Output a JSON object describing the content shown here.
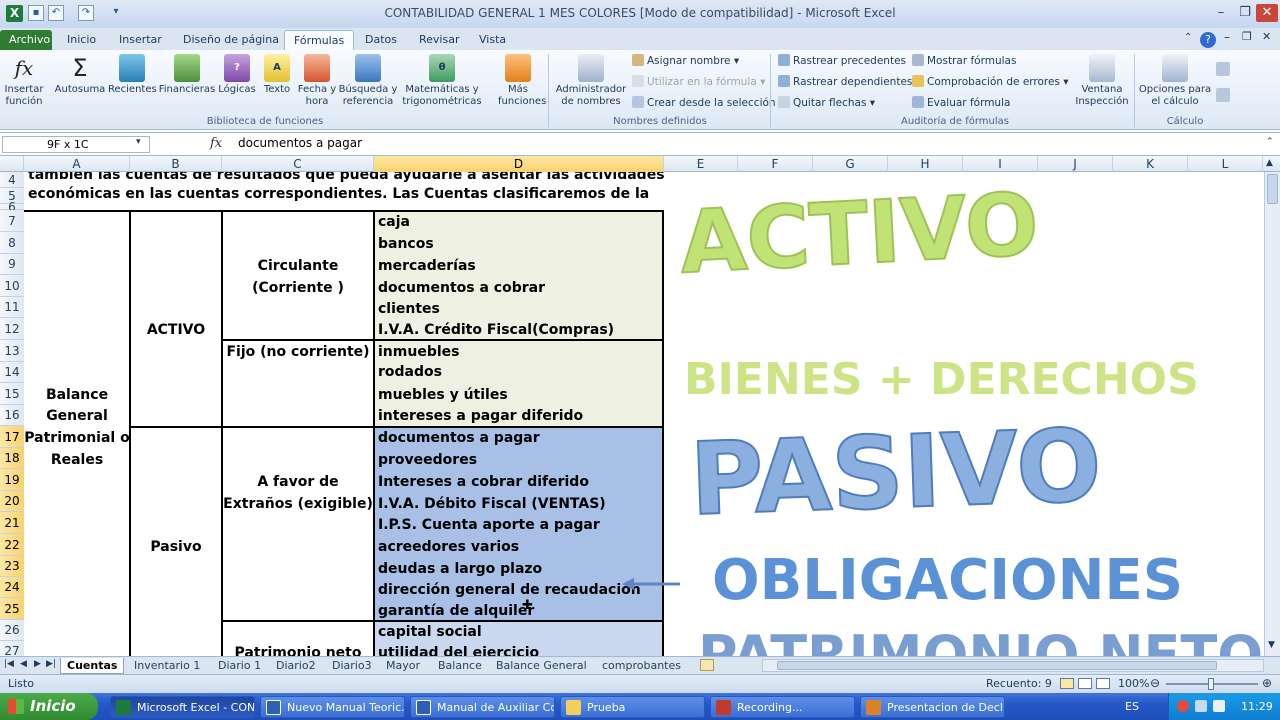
{
  "window": {
    "title": "CONTABILIDAD GENERAL 1 MES COLORES  [Modo de compatibilidad] - Microsoft Excel"
  },
  "ribbon_tabs": [
    "Archivo",
    "Inicio",
    "Insertar",
    "Diseño de página",
    "Fórmulas",
    "Datos",
    "Revisar",
    "Vista"
  ],
  "ribbon": {
    "funcs": {
      "insert": "Insertar\nfunción",
      "autosum": "Autosuma",
      "recent": "Recientes",
      "financial": "Financieras",
      "logical": "Lógicas",
      "text": "Texto",
      "datetime": "Fecha y\nhora",
      "lookup": "Búsqueda y\nreferencia",
      "math": "Matemáticas y\ntrigonométricas",
      "more": "Más\nfunciones",
      "group": "Biblioteca de funciones"
    },
    "names": {
      "manager": "Administrador\nde nombres",
      "define": "Asignar nombre",
      "use": "Utilizar en la fórmula",
      "create": "Crear desde la selección",
      "group": "Nombres definidos"
    },
    "audit": {
      "precedents": "Rastrear precedentes",
      "dependents": "Rastrear dependientes",
      "remove": "Quitar flechas",
      "show": "Mostrar fórmulas",
      "errors": "Comprobación de errores",
      "evaluate": "Evaluar fórmula",
      "watch": "Ventana\nInspección",
      "group": "Auditoría de fórmulas"
    },
    "calc": {
      "options": "Opciones para\nel cálculo",
      "group": "Cálculo"
    }
  },
  "formula_bar": {
    "name_box": "9F x 1C",
    "fx": "fx",
    "content": "documentos a pagar"
  },
  "columns": [
    "A",
    "B",
    "C",
    "D",
    "E",
    "F",
    "G",
    "H",
    "I",
    "J",
    "K",
    "L"
  ],
  "rows": [
    "4",
    "5",
    "6",
    "7",
    "8",
    "9",
    "10",
    "11",
    "12",
    "13",
    "14",
    "15",
    "16",
    "17",
    "18",
    "19",
    "20",
    "21",
    "22",
    "23",
    "24",
    "25",
    "26",
    "27"
  ],
  "sheet": {
    "intro_line1": "también las cuentas de resultados  que pueda  ayudarle  a  asentar las   actividades",
    "intro_line2": "económicas  en  las   cuentas  correspondientes.  Las Cuentas   clasificaremos de la",
    "a_balance": "Balance",
    "a_general": "General",
    "a_patrimonial": "Patrimonial o",
    "a_reales": "Reales",
    "b_activo": "ACTIVO",
    "b_pasivo": "Pasivo",
    "c_circulante": "Circulante",
    "c_corriente": "(Corriente )",
    "c_fijo": "Fijo (no corriente)",
    "c_favor": "A favor de",
    "c_extranos": "Extraños (exigible)",
    "c_patrimonio": "Patrimonio neto",
    "d_items": [
      "caja",
      "bancos",
      "mercaderías",
      "documentos a cobrar",
      "clientes",
      "I.V.A. Crédito Fiscal(Compras)",
      "inmuebles",
      "rodados",
      "muebles y útiles",
      "intereses a pagar diferido",
      "documentos a pagar",
      "proveedores",
      "Intereses a cobrar diferido",
      "I.V.A. Débito Fiscal (VENTAS)",
      "I.P.S. Cuenta aporte a pagar",
      "acreedores varios",
      "deudas a largo plazo",
      "dirección general de recaudación",
      "garantía de alquiler",
      "capital social",
      "utilidad del ejercicio"
    ]
  },
  "overlay": {
    "activo": "ACTIVO",
    "bienes": "BIENES + DERECHOS",
    "pasivo": "PASIVO",
    "obligaciones": "OBLIGACIONES",
    "patrimonio": "PATRIMONIO NETO"
  },
  "sheet_tabs": [
    "Cuentas",
    "Inventario 1",
    "Diario 1",
    "Diario2",
    "Diario3",
    "Mayor",
    "Balance",
    "Balance General",
    "comprobantes"
  ],
  "status": {
    "ready": "Listo",
    "count": "Recuento: 9",
    "zoom": "100%"
  },
  "taskbar": {
    "start": "Inicio",
    "items": [
      "Microsoft Excel - CON...",
      "Nuevo Manual Teoric...",
      "Manual de Auxiliar Co...",
      "Prueba",
      "Recording...",
      "Presentacion de Decl..."
    ],
    "lang": "ES",
    "time": "11:29"
  },
  "colors": {
    "green_block": "#eef0e2",
    "blue_block": "#a8c0e6",
    "excel_green": "#2e7d32",
    "title_bg": "#c5d7ee"
  }
}
